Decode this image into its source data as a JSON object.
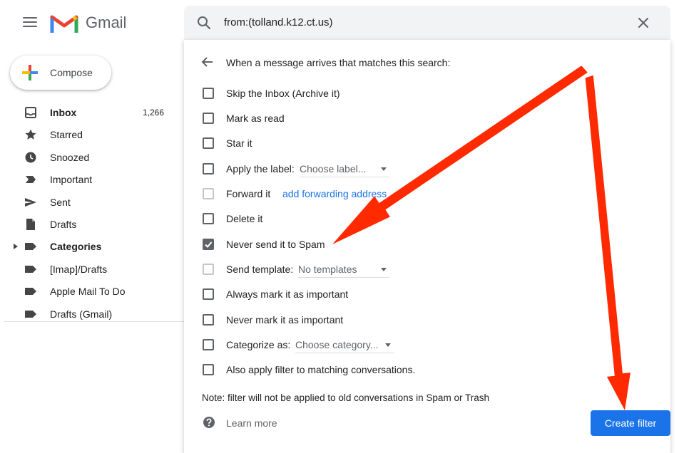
{
  "app": {
    "brand": "Gmail"
  },
  "search": {
    "query": "from:(tolland.k12.ct.us)"
  },
  "compose": {
    "label": "Compose"
  },
  "nav": [
    {
      "label": "Inbox",
      "count": "1,266",
      "icon": "inbox-icon",
      "bold": true
    },
    {
      "label": "Starred",
      "icon": "star-icon"
    },
    {
      "label": "Snoozed",
      "icon": "clock-icon"
    },
    {
      "label": "Important",
      "icon": "important-icon"
    },
    {
      "label": "Sent",
      "icon": "send-icon"
    },
    {
      "label": "Drafts",
      "icon": "draft-icon"
    },
    {
      "label": "Categories",
      "icon": "label-icon",
      "bold": true,
      "expandable": true
    },
    {
      "label": "[Imap]/Drafts",
      "icon": "label-icon"
    },
    {
      "label": "Apple Mail To Do",
      "icon": "label-icon"
    },
    {
      "label": "Drafts (Gmail)",
      "icon": "label-icon"
    }
  ],
  "filter": {
    "heading": "When a message arrives that matches this search:",
    "options": {
      "skip_inbox": "Skip the Inbox (Archive it)",
      "mark_read": "Mark as read",
      "star": "Star it",
      "apply_label": "Apply the label:",
      "apply_label_select": "Choose label...",
      "forward": "Forward it",
      "forward_link": "add forwarding address",
      "delete": "Delete it",
      "never_spam": "Never send it to Spam",
      "send_template": "Send template:",
      "send_template_select": "No templates",
      "always_important": "Always mark it as important",
      "never_important": "Never mark it as important",
      "categorize": "Categorize as:",
      "categorize_select": "Choose category...",
      "also_apply": "Also apply filter to matching conversations."
    },
    "note": "Note: filter will not be applied to old conversations in Spam or Trash",
    "learn_more": "Learn more",
    "create_button": "Create filter"
  },
  "colors": {
    "accent": "#1a73e8",
    "annotation": "#ff2a00"
  }
}
